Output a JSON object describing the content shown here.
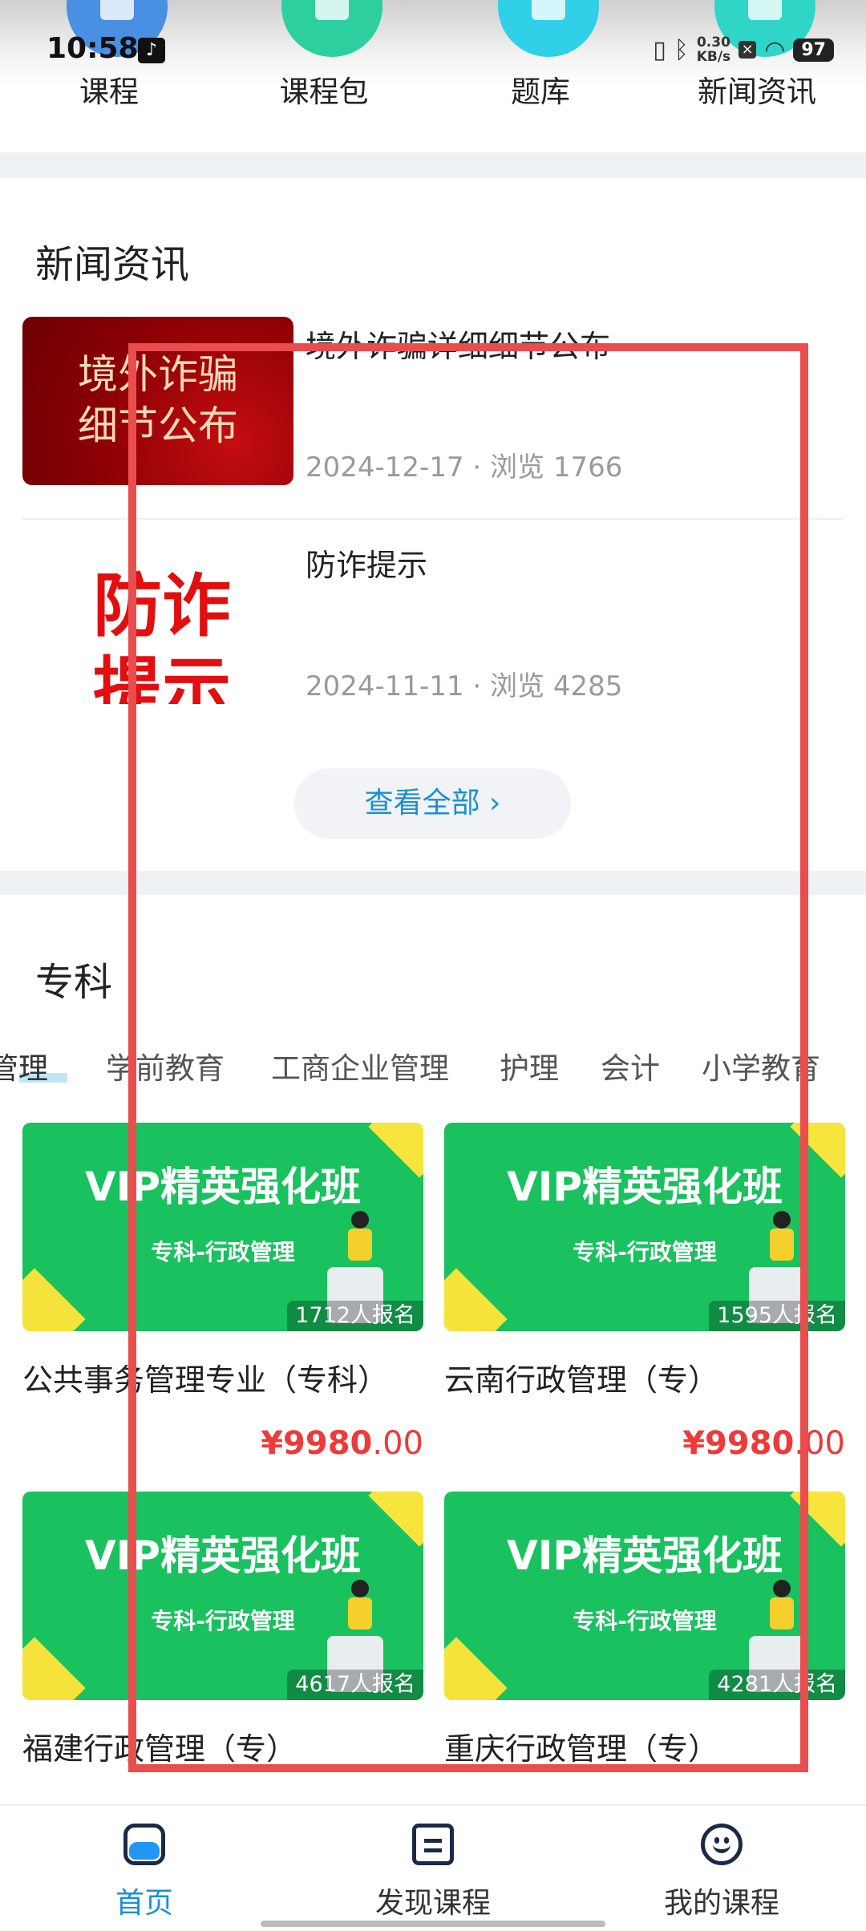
{
  "status_bar": {
    "time": "10:58",
    "net_speed_value": "0.30",
    "net_speed_unit": "KB/s",
    "battery": "97"
  },
  "quick_nav": [
    {
      "label": "课程",
      "color": "#4a90e2",
      "icon": "course-icon"
    },
    {
      "label": "课程包",
      "color": "#2dcf9f",
      "icon": "package-icon"
    },
    {
      "label": "题库",
      "color": "#2fd0e8",
      "icon": "question-bank-icon"
    },
    {
      "label": "新闻资讯",
      "color": "#2fd6c8",
      "icon": "news-icon"
    }
  ],
  "news": {
    "section_title": "新闻资讯",
    "items": [
      {
        "title": "境外诈骗详细细节公布",
        "thumb_text": "境外诈骗\n细节公布",
        "date": "2024-12-17",
        "views": "浏览 1766"
      },
      {
        "title": "防诈提示",
        "thumb_text": "防诈\n提示",
        "date": "2024-11-11",
        "views": "浏览 4285"
      }
    ],
    "meta_sep": "·",
    "view_all": "查看全部 ›"
  },
  "specialty": {
    "section_title": "专科",
    "tabs": [
      "管理",
      "学前教育",
      "工商企业管理",
      "护理",
      "会计",
      "小学教育"
    ],
    "courses": [
      {
        "cover_title": "VIP精英强化班",
        "cover_subtitle": "专科-行政管理",
        "enrolled": "1712人报名",
        "name": "公共事务管理专业（专科）",
        "price_currency": "¥",
        "price_int": "9980",
        "price_dec": ".00"
      },
      {
        "cover_title": "VIP精英强化班",
        "cover_subtitle": "专科-行政管理",
        "enrolled": "1595人报名",
        "name": "云南行政管理（专）",
        "price_currency": "¥",
        "price_int": "9980",
        "price_dec": ".00"
      },
      {
        "cover_title": "VIP精英强化班",
        "cover_subtitle": "专科-行政管理",
        "enrolled": "4617人报名",
        "name": "福建行政管理（专）"
      },
      {
        "cover_title": "VIP精英强化班",
        "cover_subtitle": "专科-行政管理",
        "enrolled": "4281人报名",
        "name": "重庆行政管理（专）"
      }
    ]
  },
  "bottom_nav": [
    {
      "label": "首页",
      "icon": "home-icon",
      "active": true
    },
    {
      "label": "发现课程",
      "icon": "discover-icon",
      "active": false
    },
    {
      "label": "我的课程",
      "icon": "my-course-icon",
      "active": false
    }
  ],
  "colors": {
    "accent": "#1a8fd6",
    "price": "#ee3a3a",
    "cover_green": "#19c15f",
    "annotation": "#e94d4d"
  }
}
